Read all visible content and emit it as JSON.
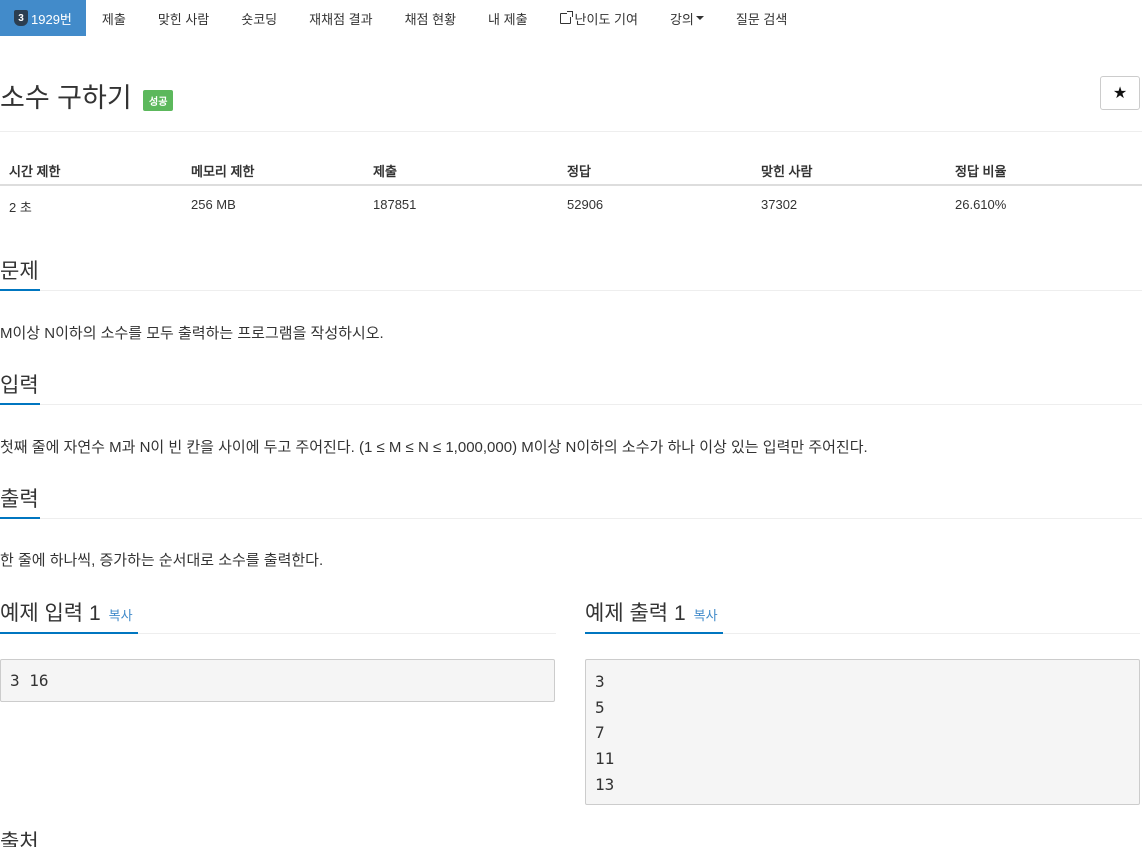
{
  "nav": {
    "problem_tab": {
      "tier": "3",
      "label": "1929번"
    },
    "items": [
      "제출",
      "맞힌 사람",
      "숏코딩",
      "재채점 결과",
      "채점 현황",
      "내 제출",
      "난이도 기여",
      "강의",
      "질문 검색"
    ]
  },
  "title": "소수 구하기",
  "badge": "성공",
  "star_icon": "★",
  "info": {
    "headers": [
      "시간 제한",
      "메모리 제한",
      "제출",
      "정답",
      "맞힌 사람",
      "정답 비율"
    ],
    "values": [
      "2 초",
      "256 MB",
      "187851",
      "52906",
      "37302",
      "26.610%"
    ]
  },
  "problem": {
    "title": "문제",
    "text": "M이상 N이하의 소수를 모두 출력하는 프로그램을 작성하시오."
  },
  "input": {
    "title": "입력",
    "text": "첫째 줄에 자연수 M과 N이 빈 칸을 사이에 두고 주어진다. (1 ≤ M ≤ N ≤ 1,000,000) M이상 N이하의 소수가 하나 이상 있는 입력만 주어진다."
  },
  "output": {
    "title": "출력",
    "text": "한 줄에 하나씩, 증가하는 순서대로 소수를 출력한다."
  },
  "sample_input": {
    "title": "예제 입력 1",
    "copy": "복사",
    "lines": [
      "3 16"
    ]
  },
  "sample_output": {
    "title": "예제 출력 1",
    "copy": "복사",
    "lines": [
      "3",
      "5",
      "7",
      "11",
      "13"
    ]
  },
  "source": {
    "title": "출처"
  },
  "colors": {
    "nav_active": "#428bca",
    "badge_success": "#5cb85c",
    "section_underline": "#0076c0",
    "copy_link": "#428bca"
  }
}
